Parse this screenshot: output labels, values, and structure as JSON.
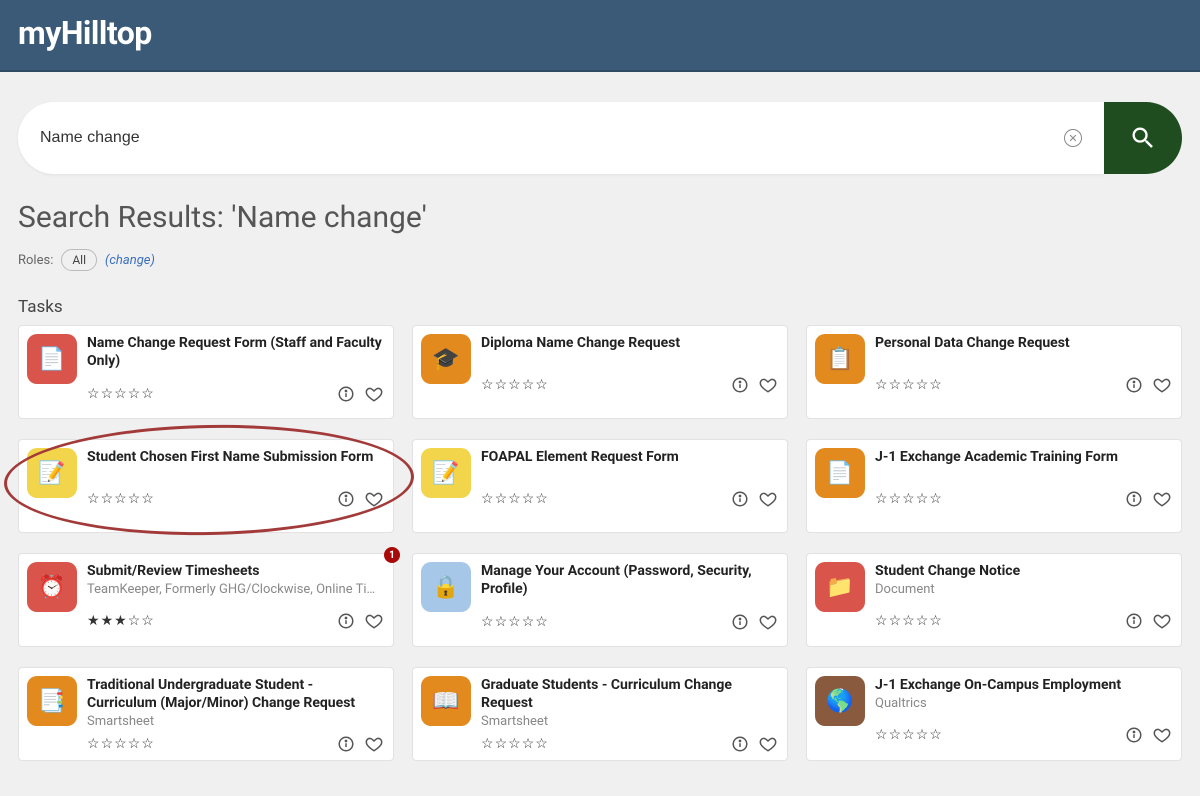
{
  "header": {
    "logo": "myHilltop"
  },
  "search": {
    "query": "Name change"
  },
  "results": {
    "heading": "Search Results: 'Name change'",
    "roles_label": "Roles:",
    "role_all": "All",
    "change_text": "(change)",
    "tasks_label": "Tasks"
  },
  "cards": [
    {
      "title": "Name Change Request Form (Staff and Faculty Only)",
      "sub": "",
      "rating": 0,
      "icon_bg": "#d9544a",
      "icon_glyph": "📄",
      "badge": ""
    },
    {
      "title": "Diploma Name Change Request",
      "sub": "",
      "rating": 0,
      "icon_bg": "#e28a1e",
      "icon_glyph": "🎓",
      "badge": ""
    },
    {
      "title": "Personal Data Change Request",
      "sub": "",
      "rating": 0,
      "icon_bg": "#e28a1e",
      "icon_glyph": "📋",
      "badge": ""
    },
    {
      "title": "Student Chosen First Name Submission Form",
      "sub": "",
      "rating": 0,
      "icon_bg": "#f2d54a",
      "icon_glyph": "📝",
      "badge": ""
    },
    {
      "title": "FOAPAL Element Request Form",
      "sub": "",
      "rating": 0,
      "icon_bg": "#f2d54a",
      "icon_glyph": "📝",
      "badge": ""
    },
    {
      "title": "J-1 Exchange Academic Training Form",
      "sub": "",
      "rating": 0,
      "icon_bg": "#e28a1e",
      "icon_glyph": "📄",
      "badge": ""
    },
    {
      "title": "Submit/Review Timesheets",
      "sub": "TeamKeeper, Formerly GHG/Clockwise, Online Timekeep…",
      "rating": 3,
      "icon_bg": "#d9544a",
      "icon_glyph": "⏰",
      "badge": "1"
    },
    {
      "title": "Manage Your Account (Password, Security, Profile)",
      "sub": "",
      "rating": 0,
      "icon_bg": "#a7c7e8",
      "icon_glyph": "🔒",
      "badge": ""
    },
    {
      "title": "Student Change Notice",
      "sub": "Document",
      "rating": 0,
      "icon_bg": "#d9544a",
      "icon_glyph": "📁",
      "badge": ""
    },
    {
      "title": "Traditional Undergraduate Student - Curriculum (Major/Minor) Change Request",
      "sub": "Smartsheet",
      "rating": 0,
      "icon_bg": "#e28a1e",
      "icon_glyph": "📑",
      "badge": ""
    },
    {
      "title": "Graduate Students - Curriculum Change Request",
      "sub": "Smartsheet",
      "rating": 0,
      "icon_bg": "#e28a1e",
      "icon_glyph": "📖",
      "badge": ""
    },
    {
      "title": "J-1 Exchange On-Campus Employment",
      "sub": "Qualtrics",
      "rating": 0,
      "icon_bg": "#8a5a3e",
      "icon_glyph": "🌎",
      "badge": ""
    }
  ]
}
